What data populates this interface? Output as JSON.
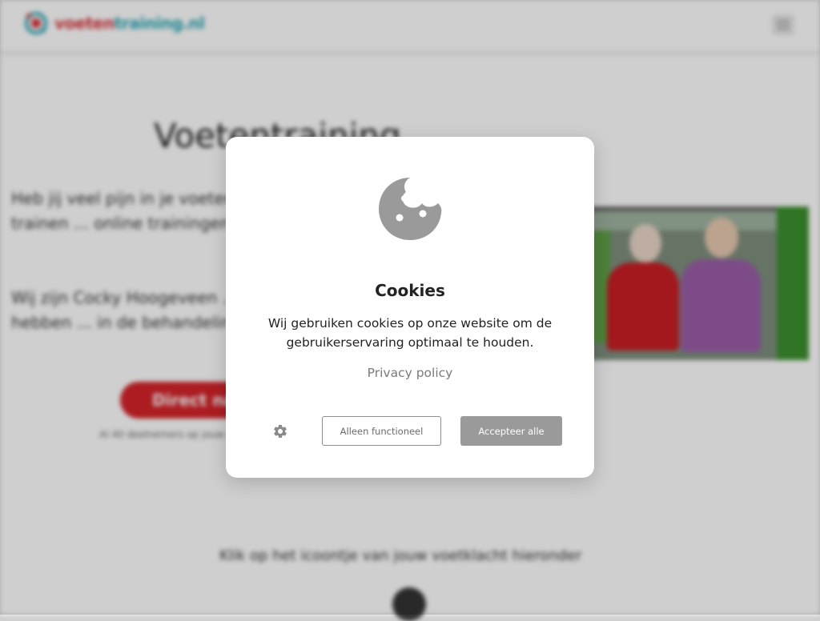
{
  "header": {
    "logo_part_1": "voeten",
    "logo_part_2": "training.nl",
    "menu_icon": "hamburger-menu-icon"
  },
  "hero": {
    "title": "Voetentraining",
    "paragraph_1": "Heb jij veel pijn in je voeten? Door je voeten te trainen ... online trainingen van Voetentraining",
    "paragraph_2": "Wij zijn Cocky Hoogeveen ... Voetentraining. Samen hebben ... in de behandeling van voetklachten",
    "cta_label": "Direct naar",
    "cta_sub": "Al 40 deelnemers op jouw plek"
  },
  "bottom": {
    "text": "Klik op het icoontje van jouw voetklacht hieronder"
  },
  "cookie_dialog": {
    "icon": "cookie-icon",
    "title": "Cookies",
    "description": "Wij gebruiken cookies op onze website om de gebruikerservaring optimaal te houden.",
    "privacy_link": "Privacy policy",
    "settings_icon": "gear-icon",
    "functional_button": "Alleen functioneel",
    "accept_button": "Accepteer alle",
    "colors": {
      "accept_bg": "#9a9a9a",
      "icon": "#9a9a9a"
    }
  }
}
